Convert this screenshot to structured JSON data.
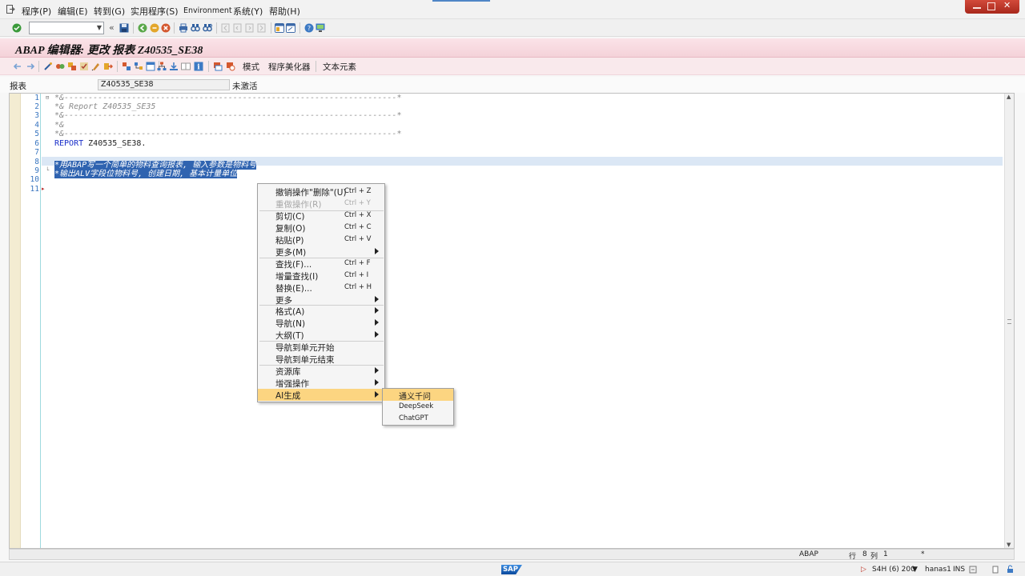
{
  "menubar": {
    "items": [
      "程序(P)",
      "编辑(E)",
      "转到(G)",
      "实用程序(S)",
      "Environment",
      "系统(Y)",
      "帮助(H)"
    ]
  },
  "title": "ABAP 编辑器: 更改 报表 Z40535_SE38",
  "app_toolbar": {
    "buttons": [
      "模式",
      "程序美化器",
      "文本元素"
    ]
  },
  "header": {
    "label": "报表",
    "program": "Z40535_SE38",
    "status": "未激活"
  },
  "editor": {
    "line_numbers": [
      "1",
      "2",
      "3",
      "4",
      "5",
      "6",
      "7",
      "8",
      "9",
      "10",
      "11"
    ],
    "lines": [
      "*&---------------------------------------------------------------------*",
      "*& Report Z40535_SE35",
      "*&---------------------------------------------------------------------*",
      "*&",
      "*&---------------------------------------------------------------------*",
      "Z40535_SE38.",
      "",
      "*用ABAP写一个简单的物料查询报表, 输入参数是物料号",
      "*输出ALV字段位物料号, 创建日期, 基本计量单位",
      "",
      ""
    ],
    "keyword_report": "REPORT"
  },
  "context_menu": {
    "items": [
      {
        "label": "撤销操作\"删除\"(U)",
        "shortcut": "Ctrl + Z"
      },
      {
        "label": "重做操作(R)",
        "shortcut": "Ctrl + Y"
      },
      {
        "label": "剪切(C)",
        "shortcut": "Ctrl + X"
      },
      {
        "label": "复制(O)",
        "shortcut": "Ctrl + C"
      },
      {
        "label": "粘贴(P)",
        "shortcut": "Ctrl + V"
      },
      {
        "label": "更多(M)",
        "shortcut": ""
      },
      {
        "label": "查找(F)...",
        "shortcut": "Ctrl + F"
      },
      {
        "label": "增量查找(I)",
        "shortcut": "Ctrl + I"
      },
      {
        "label": "替换(E)...",
        "shortcut": "Ctrl + H"
      },
      {
        "label": "更多",
        "shortcut": ""
      },
      {
        "label": "格式(A)",
        "shortcut": ""
      },
      {
        "label": "导航(N)",
        "shortcut": ""
      },
      {
        "label": "大纲(T)",
        "shortcut": ""
      },
      {
        "label": "导航到单元开始",
        "shortcut": ""
      },
      {
        "label": "导航到单元结束",
        "shortcut": ""
      },
      {
        "label": "资源库",
        "shortcut": ""
      },
      {
        "label": "增强操作",
        "shortcut": ""
      },
      {
        "label": "AI生成",
        "shortcut": ""
      }
    ]
  },
  "submenu": {
    "items": [
      "通义千问",
      "DeepSeek",
      "ChatGPT"
    ]
  },
  "editor_status": {
    "language": "ABAP",
    "row_label": "行",
    "row": "8",
    "col_label": "列",
    "col": "1",
    "marker": "*"
  },
  "statusbar": {
    "logo": "SAP",
    "system": "S4H (6) 200",
    "server": "hanas1",
    "mode": "INS"
  }
}
